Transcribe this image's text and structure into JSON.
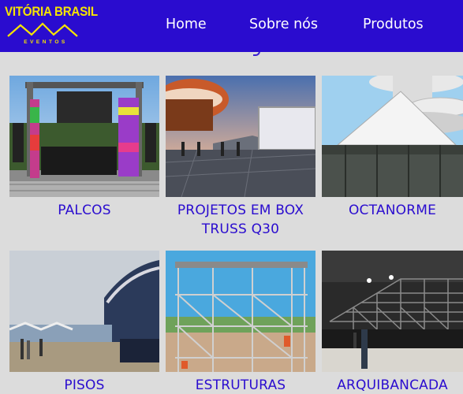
{
  "brand": {
    "name": "VITÓRIA BRASIL",
    "tagline": "EVENTOS",
    "colors": {
      "header": "#2a0ccf",
      "logo": "#f5e400",
      "label": "#2a0ccf",
      "background": "#dcdcdc"
    }
  },
  "nav": {
    "items": [
      {
        "label": "Home"
      },
      {
        "label": "Sobre nós"
      },
      {
        "label": "Produtos"
      }
    ]
  },
  "products": [
    {
      "label": "PALCOS",
      "image": "stage-photo"
    },
    {
      "label": "PROJETOS EM BOX TRUSS Q30",
      "image": "box-truss-photo"
    },
    {
      "label": "OCTANORME",
      "image": "tent-photo"
    },
    {
      "label": "PISOS",
      "image": "floor-photo"
    },
    {
      "label": "ESTRUTURAS",
      "image": "scaffold-photo"
    },
    {
      "label": "ARQUIBANCADA",
      "image": "bleachers-photo"
    }
  ]
}
